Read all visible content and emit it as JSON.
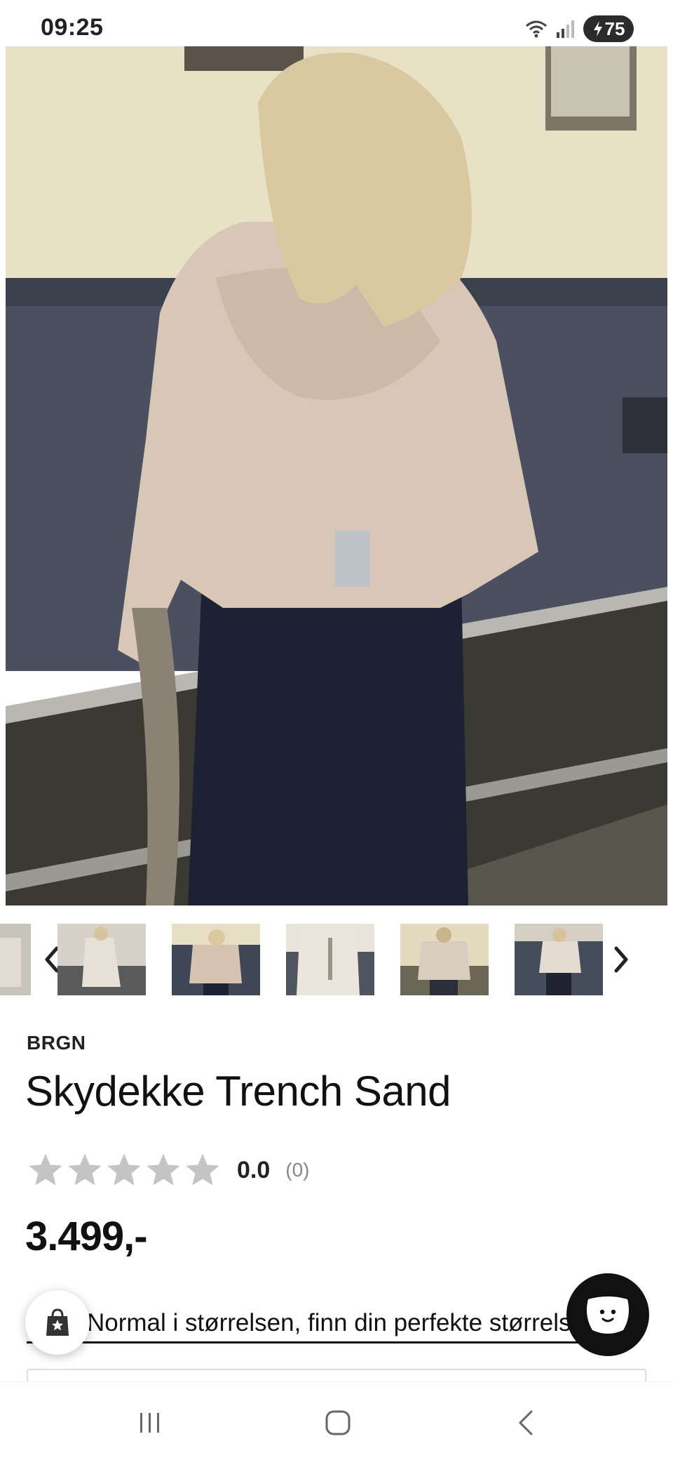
{
  "status_bar": {
    "time": "09:25",
    "battery": "75",
    "icons": [
      "wifi-icon",
      "signal-icon",
      "battery-charging-icon"
    ]
  },
  "product": {
    "brand": "BRGN",
    "title": "Skydekke Trench Sand",
    "rating": {
      "value": "0.0",
      "count": "(0)",
      "stars_filled": 0,
      "stars_total": 5
    },
    "price": "3.499,-",
    "size_text": "Normal i størrelsen, finn din perfekte størrelse"
  },
  "gallery": {
    "thumbnail_count": 6,
    "icons": [
      "chevron-left-icon",
      "chevron-right-icon"
    ]
  },
  "nav_bar": {
    "icons": [
      "recent-apps-icon",
      "home-icon",
      "back-icon"
    ]
  },
  "colors": {
    "text": "#111111",
    "star_empty": "#c4c4c4",
    "muted": "#888888",
    "chat_button": "#111111"
  }
}
